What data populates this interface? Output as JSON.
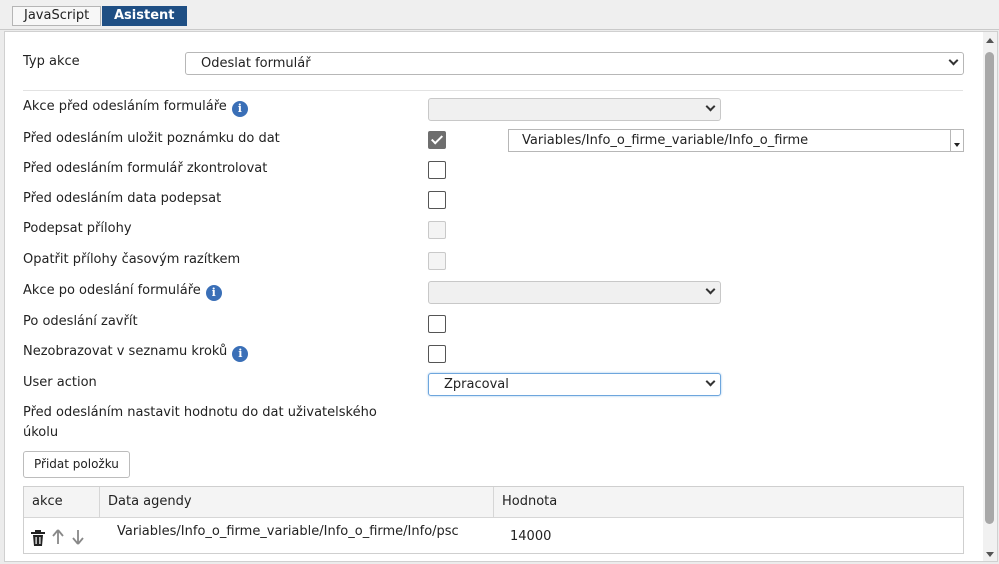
{
  "tabs": [
    {
      "label": "JavaScript",
      "active": false
    },
    {
      "label": "Asistent",
      "active": true
    }
  ],
  "form": {
    "typ_akce": {
      "label": "Typ akce",
      "value": "Odeslat formulář"
    },
    "akce_pred": {
      "label": "Akce před odesláním formuláře",
      "value": ""
    },
    "ulozit_poznamku": {
      "label": "Před odesláním uložit poznámku do dat",
      "checked": true,
      "path_value": "Variables/Info_o_firme_variable/Info_o_firme"
    },
    "zkontrolovat": {
      "label": "Před odesláním formulář zkontrolovat",
      "checked": false
    },
    "podepsat_data": {
      "label": "Před odesláním data podepsat",
      "checked": false
    },
    "podepsat_prilohy": {
      "label": "Podepsat přílohy",
      "checked": false,
      "disabled": true
    },
    "razitko": {
      "label": "Opatřit přílohy časovým razítkem",
      "checked": false,
      "disabled": true
    },
    "akce_po": {
      "label": "Akce po odeslání formuláře",
      "value": ""
    },
    "zavrit": {
      "label": "Po odeslání zavřít",
      "checked": false
    },
    "nezobrazovat": {
      "label": "Nezobrazovat v seznamu kroků",
      "checked": false
    },
    "user_action": {
      "label": "User action",
      "value": "Zpracoval"
    },
    "nastavit_hodnotu": {
      "label": "Před odesláním nastavit hodnotu do dat uživatelského úkolu"
    }
  },
  "add_button": "Přidat položku",
  "grid": {
    "headers": [
      "akce",
      "Data agendy",
      "Hodnota"
    ],
    "rows": [
      {
        "data_agendy": "Variables/Info_o_firme_variable/Info_o_firme/Info/psc",
        "hodnota": "14000"
      }
    ]
  },
  "icons": {
    "info": "info-icon",
    "trash": "trash-icon",
    "up": "arrow-up-icon",
    "down": "arrow-down-icon",
    "chevron": "chevron-down-icon"
  },
  "colors": {
    "accent": "#1f4f84",
    "info": "#3a6fb7"
  }
}
